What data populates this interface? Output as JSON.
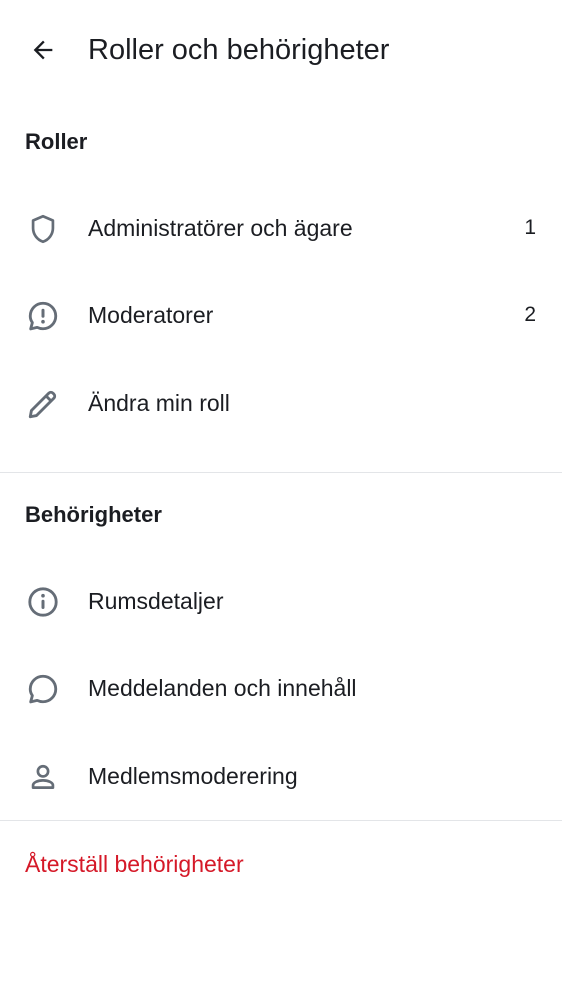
{
  "header": {
    "title": "Roller och behörigheter",
    "back_icon": "arrow-left-icon"
  },
  "roles": {
    "header": "Roller",
    "items": [
      {
        "label": "Administratörer och ägare",
        "count": "1",
        "icon": "shield-icon"
      },
      {
        "label": "Moderatorer",
        "count": "2",
        "icon": "chat-alert-icon"
      },
      {
        "label": "Ändra min roll",
        "icon": "pencil-icon"
      }
    ]
  },
  "permissions": {
    "header": "Behörigheter",
    "items": [
      {
        "label": "Rumsdetaljer",
        "icon": "info-icon"
      },
      {
        "label": "Meddelanden och innehåll",
        "icon": "chat-bubble-icon"
      },
      {
        "label": "Medlemsmoderering",
        "icon": "user-icon"
      }
    ]
  },
  "reset": {
    "label": "Återställ behörigheter"
  },
  "colors": {
    "text": "#1b1d22",
    "icon": "#656d77",
    "danger": "#d51928",
    "divider": "#e3e5e8",
    "background": "#ffffff"
  }
}
